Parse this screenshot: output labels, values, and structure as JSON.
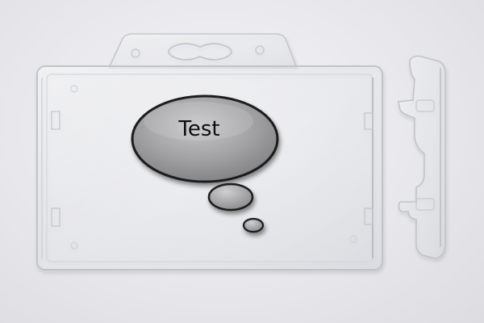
{
  "bubble": {
    "text": "Test"
  },
  "colors": {
    "background": "#e8e8ec",
    "holder_edge": "#c4c8ce",
    "bubble_fill": "#9a9a9c",
    "bubble_outline": "#1a1a1a"
  }
}
